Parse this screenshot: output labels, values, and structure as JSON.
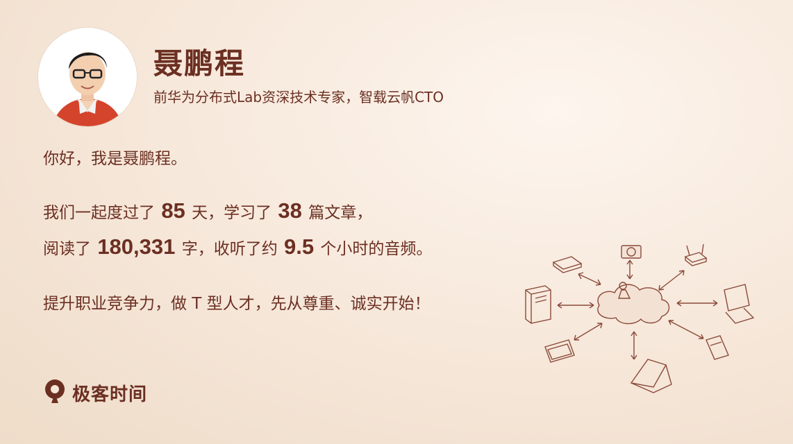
{
  "profile": {
    "name": "聂鹏程",
    "title": "前华为分布式Lab资深技术专家，智载云帆CTO"
  },
  "greeting": "你好，我是聂鹏程。",
  "stats": {
    "line1_prefix": "我们一起度过了",
    "days": "85",
    "line1_mid": "天，学习了",
    "articles": "38",
    "line1_suffix": "篇文章，",
    "line2_prefix": "阅读了",
    "words": "180,331",
    "line2_mid": "字，收听了约",
    "hours": "9.5",
    "line2_suffix": "个小时的音频。"
  },
  "slogan": "提升职业竞争力，做 T 型人才，先从尊重、诚实开始！",
  "brand": {
    "name": "极客时间",
    "icon": "geektime-logo-icon",
    "color": "#6b2f22"
  },
  "illustration": {
    "icon": "network-cloud-icon"
  }
}
